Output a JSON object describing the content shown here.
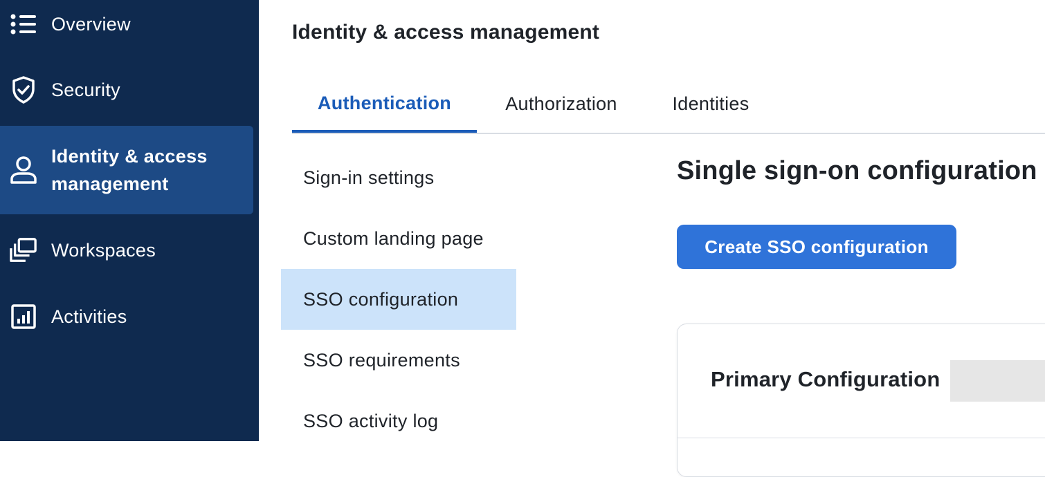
{
  "sidebar": {
    "items": [
      {
        "label": "Overview",
        "icon": "list-icon"
      },
      {
        "label": "Security",
        "icon": "shield-icon"
      },
      {
        "label": "Identity & access\nmanagement",
        "icon": "user-icon",
        "active": true
      },
      {
        "label": "Workspaces",
        "icon": "workspaces-icon"
      },
      {
        "label": "Activities",
        "icon": "chart-icon"
      }
    ]
  },
  "page": {
    "title": "Identity & access management"
  },
  "tabs": [
    {
      "label": "Authentication",
      "active": true
    },
    {
      "label": "Authorization"
    },
    {
      "label": "Identities"
    }
  ],
  "subnav": [
    {
      "label": "Sign-in settings"
    },
    {
      "label": "Custom landing page"
    },
    {
      "label": "SSO configuration",
      "active": true
    },
    {
      "label": "SSO requirements"
    },
    {
      "label": "SSO activity log"
    }
  ],
  "content": {
    "title": "Single sign-on configuration",
    "create_button": "Create SSO configuration",
    "card_title": "Primary Configuration"
  },
  "colors": {
    "sidebar_bg": "#0f2a4f",
    "sidebar_active": "#1d4a85",
    "accent": "#1b5cb8",
    "button": "#2f73d9",
    "subnav_active": "#cce3fa"
  }
}
